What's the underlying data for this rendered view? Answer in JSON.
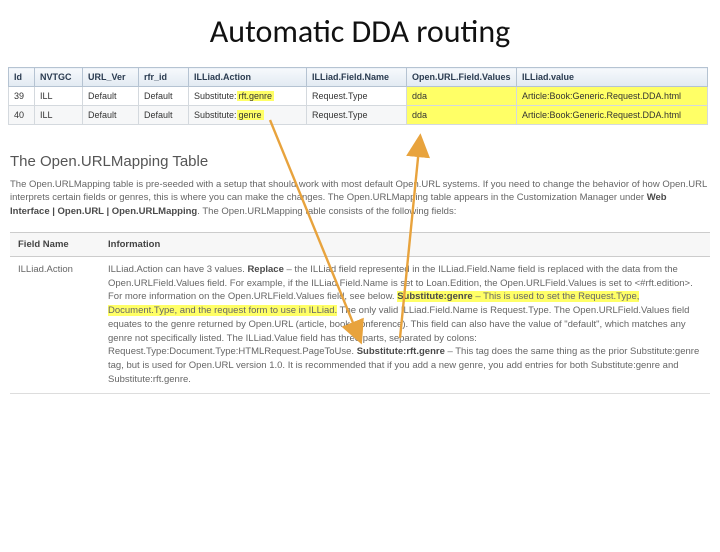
{
  "title": "Automatic DDA routing",
  "dataTable": {
    "headers": [
      "Id",
      "NVTGC",
      "URL_Ver",
      "rfr_id",
      "ILLiad.Action",
      "ILLiad.Field.Name",
      "Open.URL.Field.Values",
      "ILLiad.value"
    ],
    "rows": [
      {
        "id": "39",
        "nvtgc": "ILL",
        "urlver": "Default",
        "rfrid": "Default",
        "action_pre": "Substitute:",
        "action_hl": "rft.genre",
        "fieldname": "Request.Type",
        "openurlfv": "dda",
        "illiadvalue": "Article:Book:Generic.Request.DDA.html"
      },
      {
        "id": "40",
        "nvtgc": "ILL",
        "urlver": "Default",
        "rfrid": "Default",
        "action_pre": "Substitute:",
        "action_hl": "genre",
        "fieldname": "Request.Type",
        "openurlfv": "dda",
        "illiadvalue": "Article:Book:Generic.Request.DDA.html"
      }
    ]
  },
  "section": {
    "heading": "The Open.URLMapping Table",
    "para_parts": {
      "p1": "The Open.URLMapping table is pre-seeded with a setup that should work with most default Open.URL systems. If you need to change the behavior of how Open.URL interprets certain fields or genres, this is where you can make the changes. The Open.URLMapping table appears in the Customization Manager under ",
      "p2": "Web Interface | Open.URL | Open.URLMapping",
      "p3": ". The Open.URLMapping table consists of the following fields:"
    }
  },
  "fieldTable": {
    "headers": [
      "Field Name",
      "Information"
    ],
    "row": {
      "name": "ILLiad.Action",
      "seg1": "ILLiad.Action can have 3 values. ",
      "b1": "Replace",
      "seg2": " – the ILLiad field represented in the ILLiad.Field.Name field is replaced with the data from the Open.URLField.Values field. For example, if the ILLiad.Field.Name is set to Loan.Edition, the Open.URLField.Values is set to <#rft.edition>. For more information on the Open.URLField.Values field, see below. ",
      "hl_b": "Substitute:genre",
      "hl_rest": " – This is used to set the Request.Type, Document.Type, and the request form to use in ILLiad.",
      "seg3": " The only valid ILLiad.Field.Name is Request.Type. The Open.URLField.Values field equates to the genre returned by Open.URL (article, book, conference). This field can also have the value of \"default\", which matches any genre not specifically listed. The ILLiad.Value field has three parts, separated by colons: Request.Type:Document.Type:HTMLRequest.PageToUse. ",
      "b2": "Substitute:rft.genre",
      "seg4": " – This tag does the same thing as the prior Substitute:genre tag, but is used for Open.URL version 1.0. It is recommended that if you add a new genre, you add entries for both Substitute:genre and Substitute:rft.genre."
    }
  }
}
